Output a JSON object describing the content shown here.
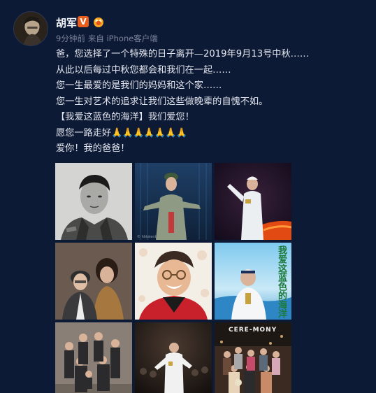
{
  "post": {
    "author": "胡军",
    "verified_mark": "V",
    "time": "9分钟前",
    "source": "来自 iPhone客户端",
    "lines": [
      "爸，您选择了一个特殊的日子离开—2019年9月13号中秋……",
      "从此以后每过中秋您都会和我们在一起……",
      "您一生最爱的是我们的妈妈和这个家……",
      "您一生对艺术的追求让我们这些做晚辈的自愧不如。",
      "【我爱这蓝色的海洋】我们爱您！",
      "愿您一路走好",
      "爱你！我的爸爸！"
    ],
    "pray_emojis": "🙏🙏🙏🙏🙏🙏🙏"
  },
  "images": [
    {
      "name": "photo-young-soldier-portrait"
    },
    {
      "name": "photo-stage-singing-uniform"
    },
    {
      "name": "photo-stage-white-uniform"
    },
    {
      "name": "photo-couple-portrait"
    },
    {
      "name": "photo-smiling-man-glasses"
    },
    {
      "name": "photo-album-cover-blue-ocean",
      "cover_text": "我爱这蓝色的海洋"
    },
    {
      "name": "photo-family-group"
    },
    {
      "name": "photo-concert-stage"
    },
    {
      "name": "photo-family-restaurant",
      "sign_text": "CERE-MONY"
    }
  ],
  "colors": {
    "background": "#0d1a36",
    "text": "#e3e6ee",
    "meta": "#7b8399",
    "badge_v": "#e85d1c"
  }
}
